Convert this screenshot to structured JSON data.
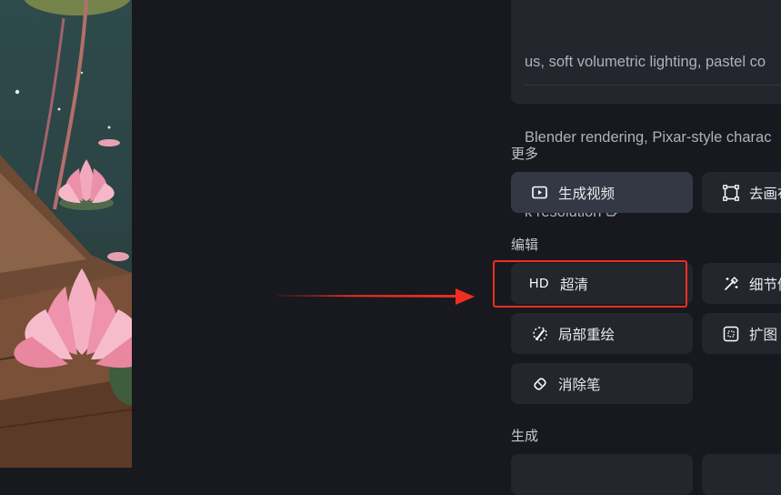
{
  "prompt": {
    "lines": [
      "us, soft volumetric lighting, pastel co",
      "Blender rendering, Pixar-style charac",
      "k resolution"
    ],
    "copy_icon": "copy-icon"
  },
  "sections": {
    "more": "更多",
    "edit": "编辑",
    "generate": "生成"
  },
  "buttons": {
    "generate_video": "生成视频",
    "remove_bg": "去画布",
    "hd_badge": "HD",
    "upscale": "超清",
    "detail": "细节修",
    "inpaint": "局部重绘",
    "expand": "扩图",
    "eraser": "消除笔"
  },
  "colors": {
    "background": "#17191f",
    "card": "#23262d",
    "active_button": "#343844",
    "highlight": "#ef2d21"
  }
}
